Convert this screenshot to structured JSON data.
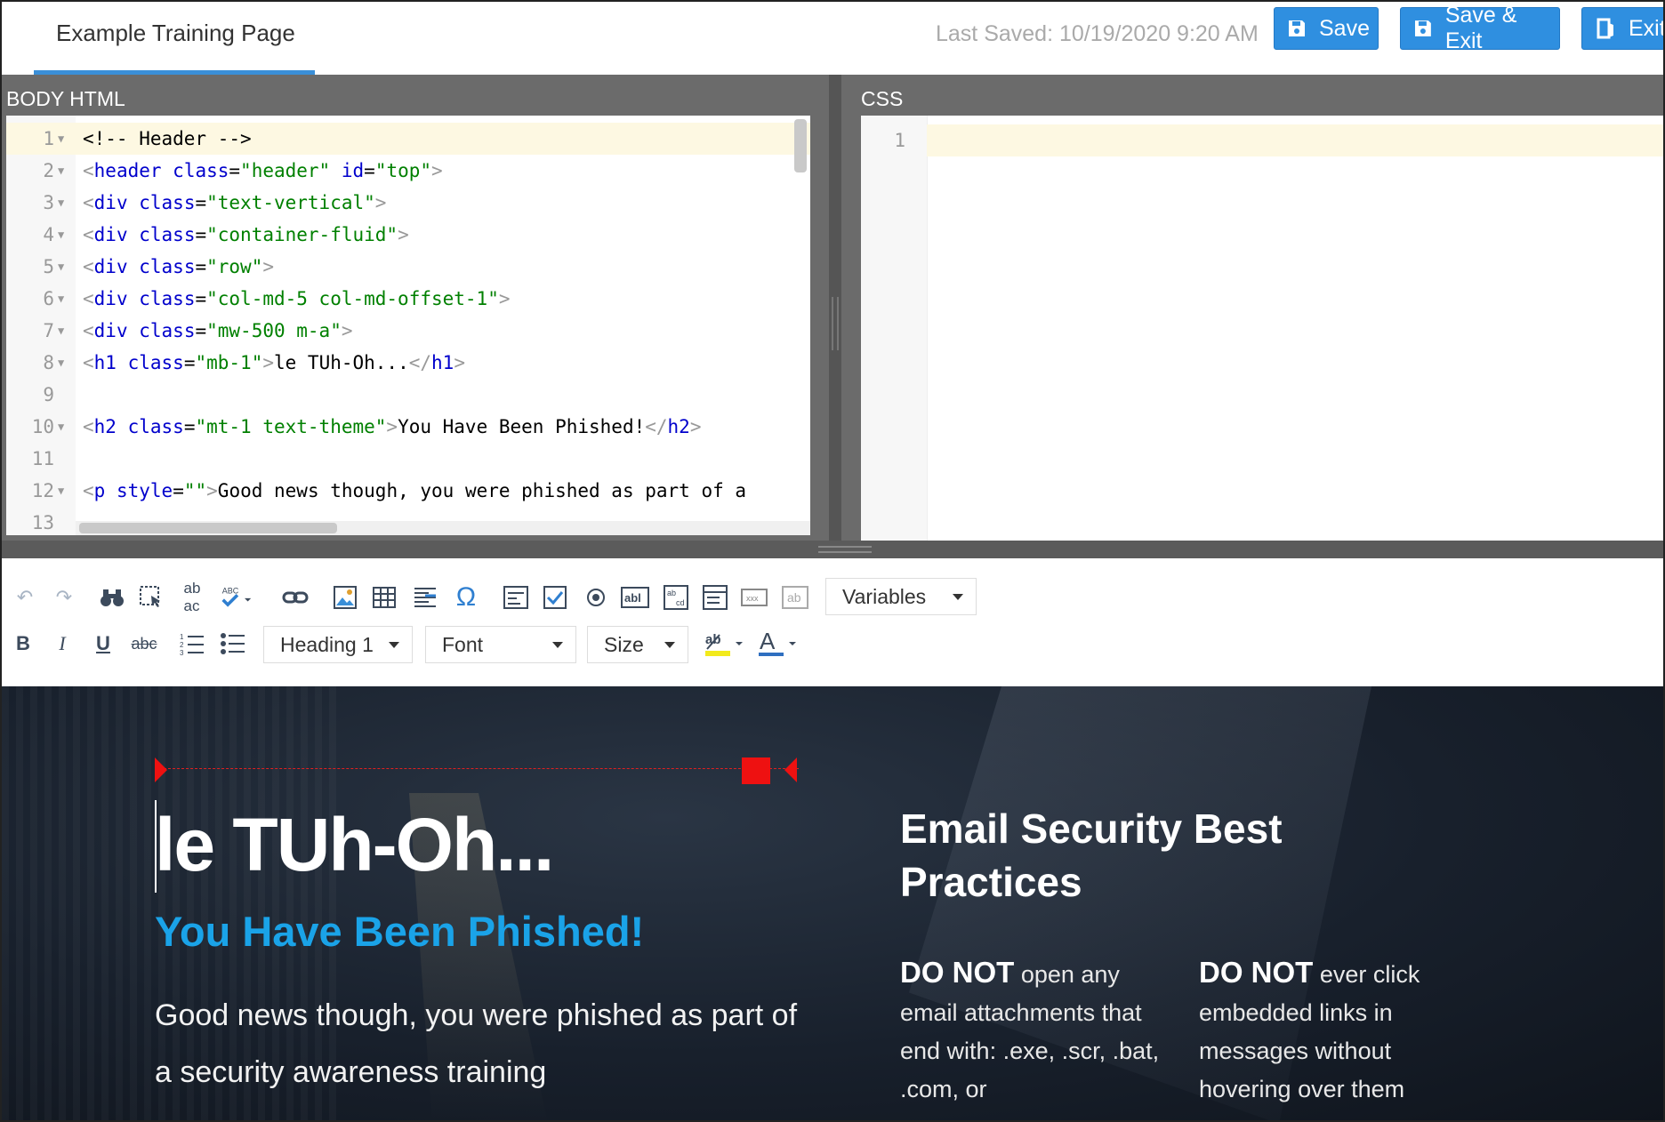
{
  "header": {
    "tab_title": "Example Training Page",
    "last_saved": "Last Saved: 10/19/2020 9:20 AM",
    "save_label": "Save",
    "save_exit_label": "Save & Exit",
    "exit_label": "Exit"
  },
  "html_pane": {
    "label": "BODY HTML",
    "line_numbers": [
      "1",
      "2",
      "3",
      "4",
      "5",
      "6",
      "7",
      "8",
      "9",
      "10",
      "11",
      "12",
      "13"
    ]
  },
  "css_pane": {
    "label": "CSS",
    "line_numbers": [
      "1"
    ]
  },
  "toolbar": {
    "variables_label": "Variables",
    "format_label": "Heading 1",
    "font_label": "Font",
    "size_label": "Size"
  },
  "preview": {
    "h1": "le TUh-Oh...",
    "h2": "You Have Been Phished!",
    "paragraph": "Good news though, you were phished as part of a security awareness training",
    "best_title": "Email Security Best Practices",
    "col1_bold": "DO NOT",
    "col1_text": " open any email attachments that end with: .exe, .scr, .bat, .com, or",
    "col2_bold": "DO NOT",
    "col2_text": " ever click embedded links in messages without hovering over them"
  },
  "colors": {
    "accent_blue": "#2f8fe0",
    "heading_cyan": "#1aa3e8",
    "ruler_red": "#ee1111"
  }
}
